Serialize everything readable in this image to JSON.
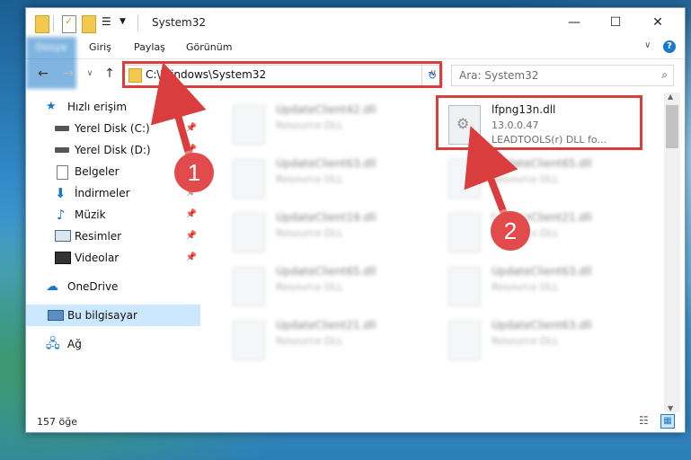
{
  "window": {
    "title": "System32",
    "buttons": {
      "minimize": "—",
      "maximize": "☐",
      "close": "✕"
    }
  },
  "ribbon": {
    "tabs": [
      "Dosya",
      "Giriş",
      "Paylaş",
      "Görünüm"
    ]
  },
  "nav": {
    "address": "C:\\Windows\\System32",
    "search_placeholder": "Ara: System32"
  },
  "sidebar": {
    "items": [
      {
        "label": "Hızlı erişim",
        "icon": "star-icon"
      },
      {
        "label": "Yerel Disk (C:)",
        "icon": "drive-icon"
      },
      {
        "label": "Yerel Disk (D:)",
        "icon": "drive-icon"
      },
      {
        "label": "Belgeler",
        "icon": "document-icon"
      },
      {
        "label": "İndirmeler",
        "icon": "download-icon"
      },
      {
        "label": "Müzik",
        "icon": "music-icon"
      },
      {
        "label": "Resimler",
        "icon": "picture-icon"
      },
      {
        "label": "Videolar",
        "icon": "video-icon"
      },
      {
        "label": "OneDrive",
        "icon": "cloud-icon"
      },
      {
        "label": "Bu bilgisayar",
        "icon": "computer-icon"
      },
      {
        "label": "Ağ",
        "icon": "network-icon"
      }
    ]
  },
  "files": [
    {
      "name": "UpdateClient42.dll",
      "type": "Resource DLL"
    },
    {
      "name": "lfpng13n.dll",
      "version": "13.0.0.47",
      "desc": "LEADTOOLS(r) DLL fo..."
    },
    {
      "name": "UpdateClient63.dll",
      "type": "Resource DLL"
    },
    {
      "name": "UpdateClient65.dll",
      "type": "Resource DLL"
    },
    {
      "name": "UpdateClient19.dll",
      "type": "Resource DLL"
    },
    {
      "name": "UpdateClient21.dll",
      "type": "Resource DLL"
    },
    {
      "name": "UpdateClient65.dll",
      "type": "Resource DLL"
    },
    {
      "name": "UpdateClient63.dll",
      "type": "Resource DLL"
    },
    {
      "name": "UpdateClient21.dll",
      "type": "Resource DLL"
    },
    {
      "name": "UpdateClient63.dll",
      "type": "Resource DLL"
    }
  ],
  "status": {
    "count": "157 öğe"
  },
  "annotations": {
    "step1": "1",
    "step2": "2",
    "color": "#d93d3d"
  }
}
